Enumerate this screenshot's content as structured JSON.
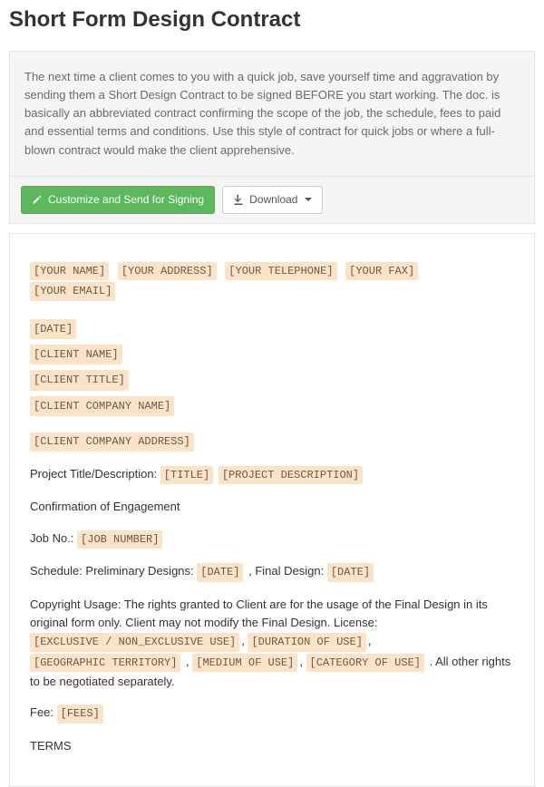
{
  "title": "Short Form Design Contract",
  "intro": "The next time a client comes to you with a quick job, save yourself time and aggravation by sending them a Short Design Contract to be signed BEFORE you start working. The doc. is basically an abbreviated contract confirming the scope of the job, the schedule, fees to paid and essential terms and conditions. Use this style of contract for quick jobs or where a full-blown contract would make the client apprehensive.",
  "toolbar": {
    "customize_label": "Customize and Send for Signing",
    "download_label": "Download"
  },
  "doc": {
    "header_tokens": [
      "[YOUR NAME]",
      "[YOUR ADDRESS]",
      "[YOUR TELEPHONE]",
      "[YOUR FAX]",
      "[YOUR EMAIL]"
    ],
    "client_block": [
      "[DATE]",
      "[CLIENT NAME]",
      "[CLIENT TITLE]",
      "[CLIENT COMPANY NAME]"
    ],
    "client_address": "[CLIENT COMPANY ADDRESS]",
    "project_label": "Project Title/Description:",
    "project_title": "[TITLE]",
    "project_desc": "[PROJECT DESCRIPTION]",
    "confirmation": "Confirmation of Engagement",
    "jobno_label": "Job No.:",
    "jobno": "[JOB NUMBER]",
    "schedule_label": "Schedule: Preliminary Designs:",
    "schedule_date1": "[DATE]",
    "final_label": ", Final Design:",
    "schedule_date2": "[DATE]",
    "copyright_pre": "Copyright Usage: The rights granted to Client are for the usage of the Final Design in its original form only. Client may not modify the Final Design. License:",
    "license_tokens": [
      "[EXCLUSIVE / NON_EXCLUSIVE USE]",
      "[DURATION OF USE]",
      "[GEOGRAPHIC TERRITORY]",
      "[MEDIUM OF USE]",
      "[CATEGORY OF USE]"
    ],
    "copyright_post": ". All other rights to be negotiated separately.",
    "fee_label": "Fee:",
    "fee": "[FEES]",
    "terms_heading": "TERMS"
  }
}
